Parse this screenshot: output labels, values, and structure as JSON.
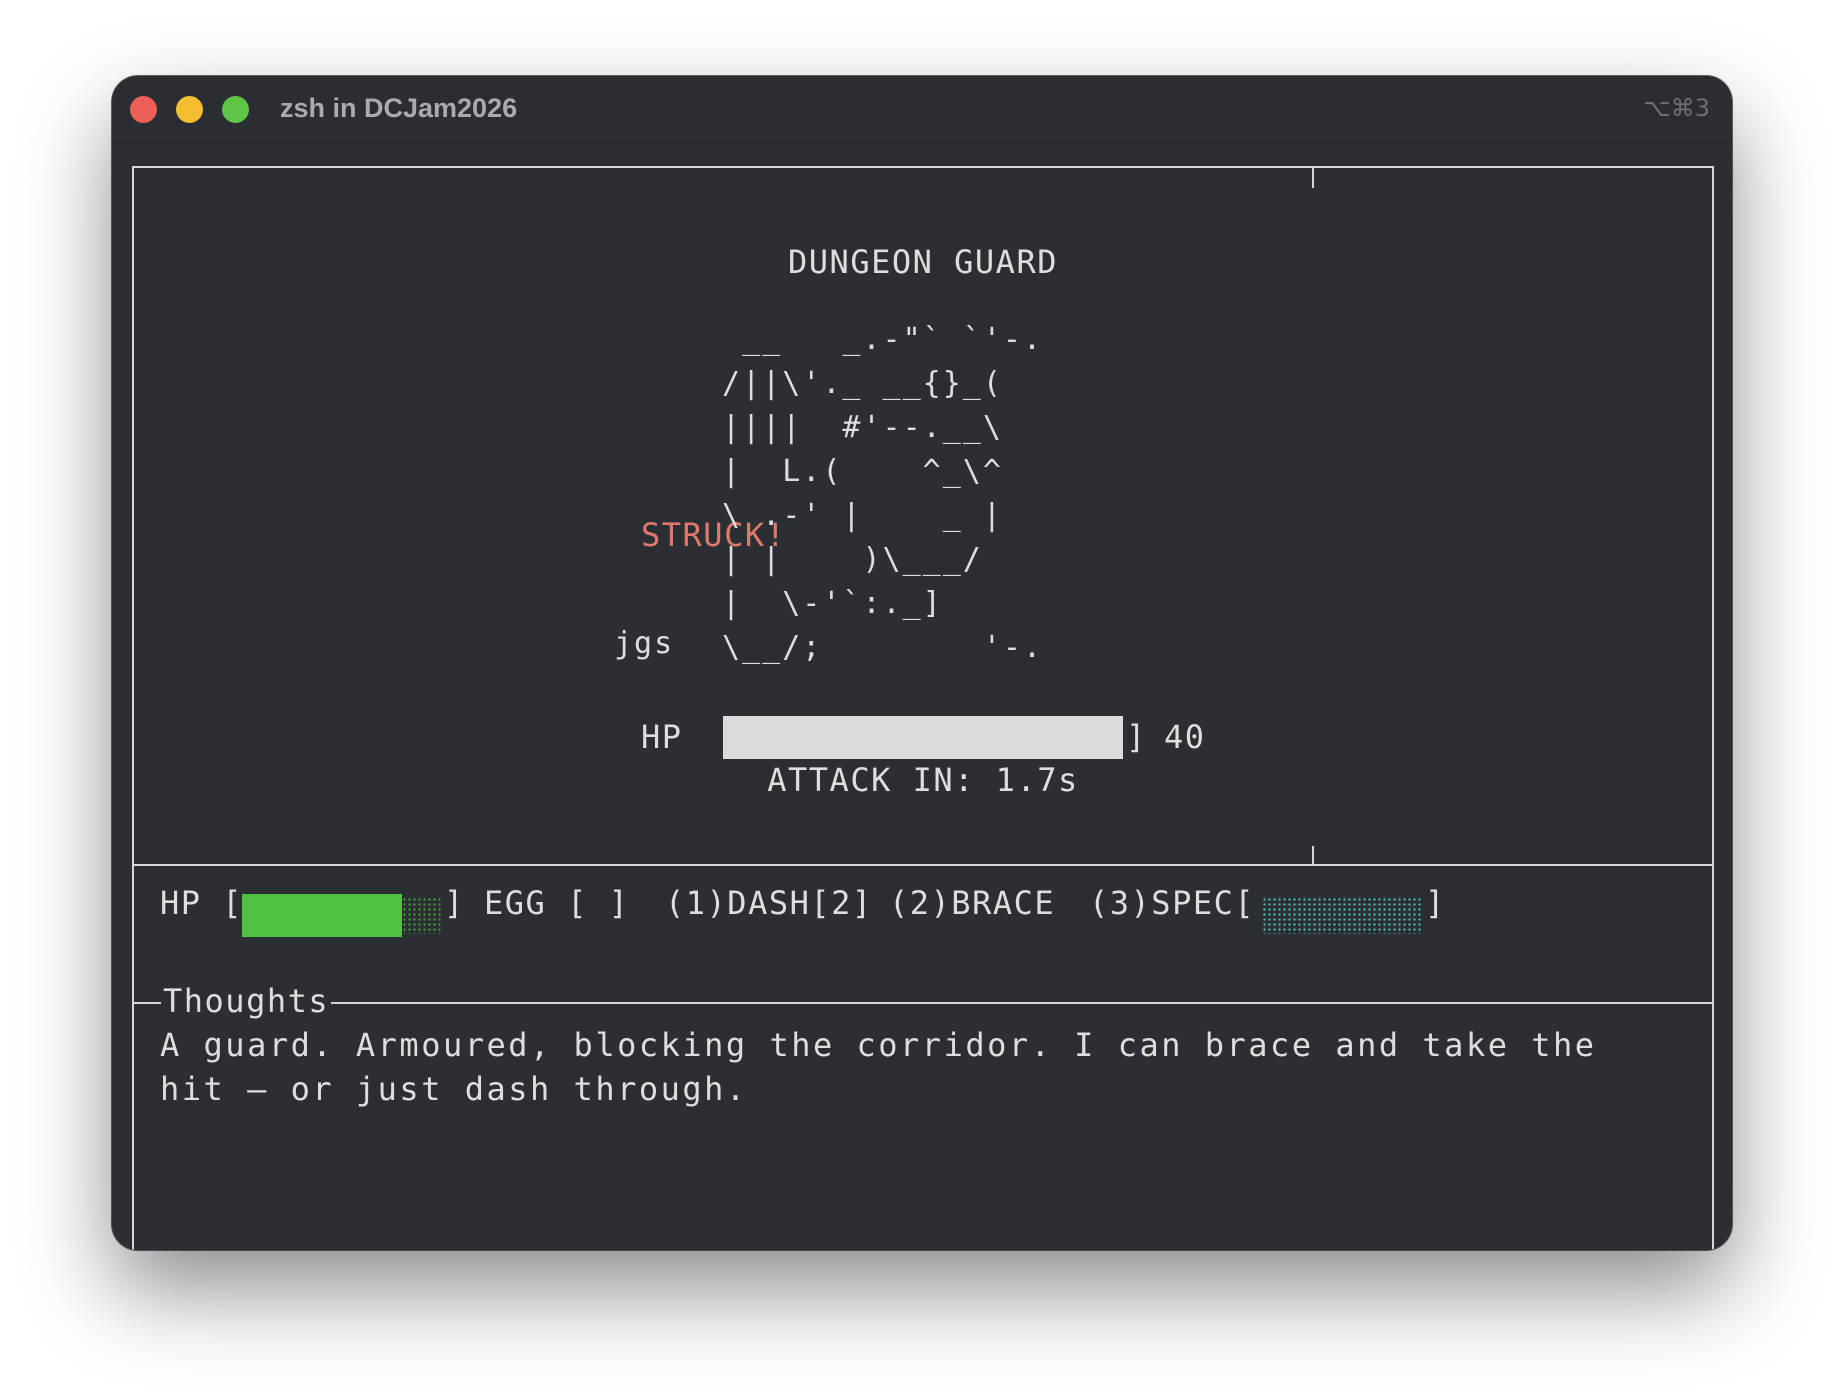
{
  "window": {
    "title": "zsh in DCJam2026",
    "shortcut": "⌥⌘3"
  },
  "encounter": {
    "enemy_name": "DUNGEON GUARD",
    "struck_label": "STRUCK!",
    "ascii_art": "  __   _.-\"` `'-.\n /||\\'._ __{}_(\n ||||  #'--.__\\\n |  L.(    ^_\\^\n \\ .-' |    _ |\n | |    )\\___/\n |  \\-'`:._]\n \\__/;        '-.",
    "art_signature": "jgs",
    "enemy_hp_label": "HP",
    "enemy_hp_open": "[",
    "enemy_hp_close": "]",
    "enemy_hp_value": "40",
    "enemy_hp_fraction": 1.0,
    "attack_timer": "ATTACK IN: 1.7s"
  },
  "status": {
    "hp_label": "HP [",
    "hp_close": "]",
    "hp_fraction": 0.8,
    "egg": "EGG [ ]",
    "dash": "(1)DASH[2]",
    "brace": "(2)BRACE",
    "spec_label": "(3)SPEC[",
    "spec_close": "]",
    "spec_fraction": 0.0
  },
  "thoughts": {
    "title": "Thoughts",
    "text": "A guard. Armoured, blocking the corridor. I can brace and take the hit — or just dash through."
  },
  "colors": {
    "background": "#2b2e33",
    "foreground": "#dedede",
    "struck": "#e0786c",
    "player_hp": "#4fc23f",
    "spec": "#4bb3b3"
  }
}
